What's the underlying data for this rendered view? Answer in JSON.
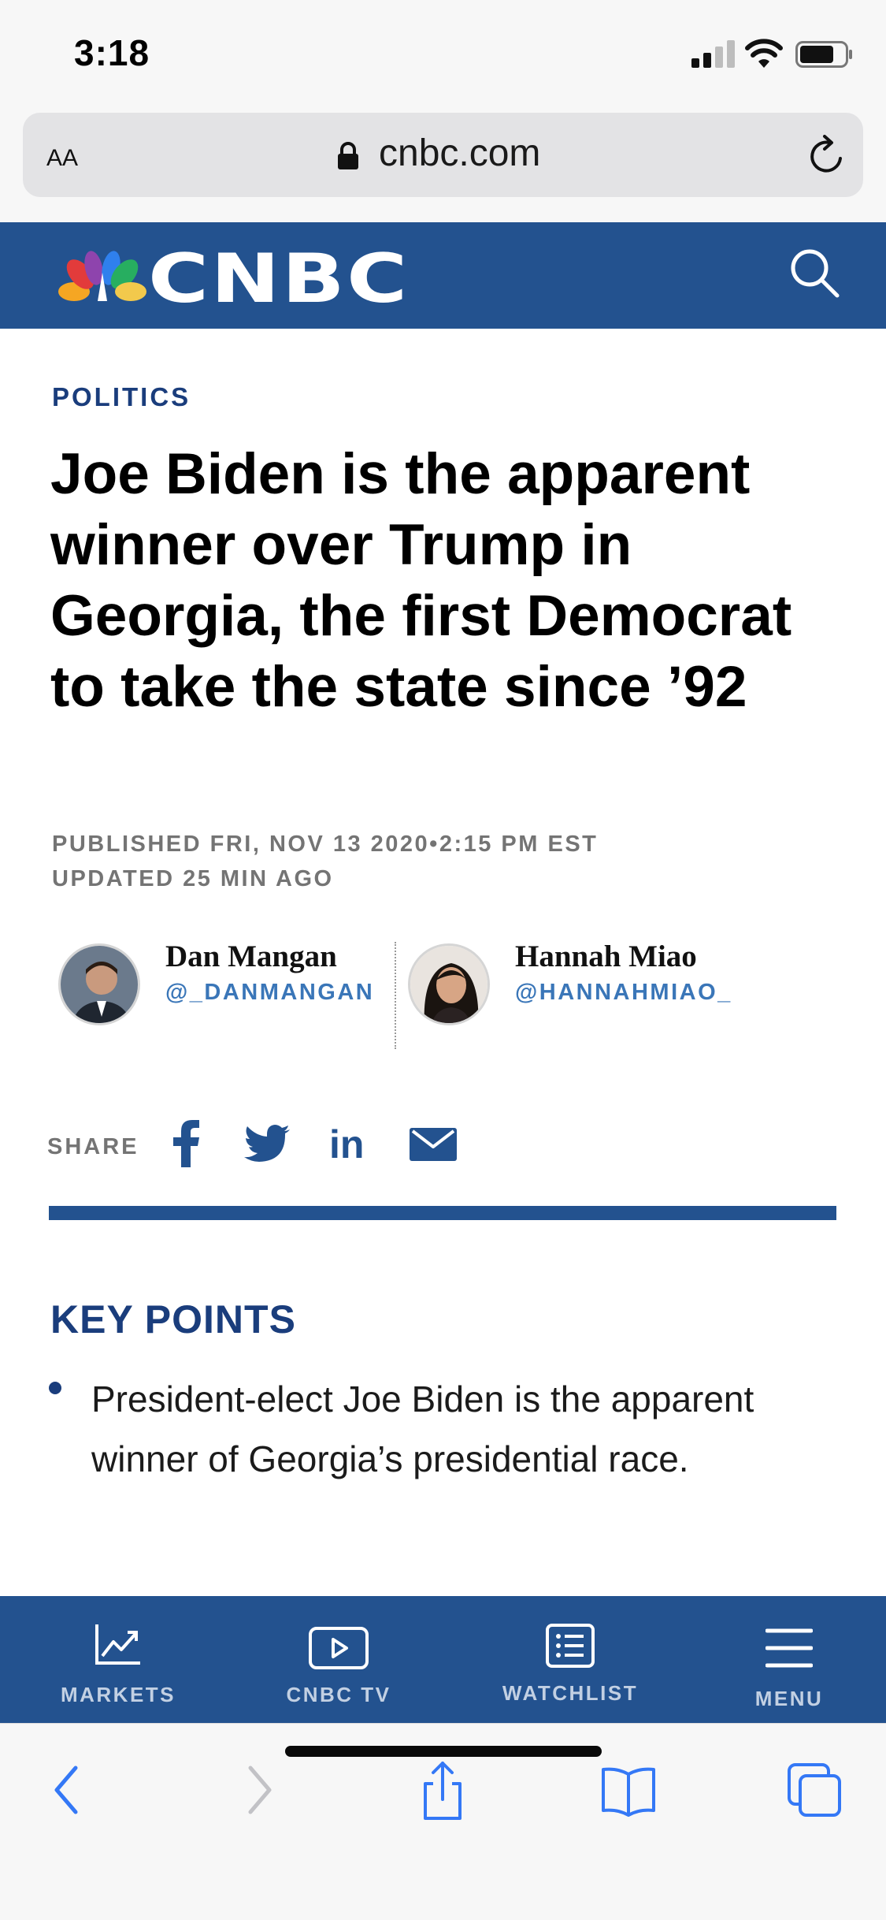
{
  "status_bar": {
    "time": "3:18",
    "icons": [
      "cellular-signal-icon",
      "wifi-icon",
      "battery-icon"
    ]
  },
  "browser": {
    "text_size_button": "AA",
    "url": "cnbc.com",
    "icons": [
      "lock-icon",
      "reload-icon"
    ]
  },
  "site_header": {
    "logo": "CNBC",
    "icons": [
      "nbc-peacock-icon",
      "search-icon"
    ],
    "brand_color": "#23528f"
  },
  "article": {
    "section": "POLITICS",
    "headline": "Joe Biden is the apparent winner over Trump in Georgia, the first Democrat to take the state since ’92",
    "published": "PUBLISHED FRI, NOV 13 2020•2:15 PM EST",
    "updated": "UPDATED 25 MIN AGO",
    "authors": [
      {
        "name": "Dan Mangan",
        "handle": "@_DANMANGAN"
      },
      {
        "name": "Hannah Miao",
        "handle": "@HANNAHMIAO_"
      }
    ],
    "share": {
      "label": "SHARE",
      "icons": [
        "facebook-icon",
        "twitter-icon",
        "linkedin-icon",
        "email-icon"
      ],
      "linkedin_glyph": "in"
    },
    "key_points": {
      "title": "KEY POINTS",
      "items": [
        "President-elect Joe Biden is the apparent winner of Georgia’s presidential race."
      ]
    }
  },
  "site_nav": {
    "items": [
      {
        "label": "MARKETS",
        "icon": "chart-icon"
      },
      {
        "label": "CNBC TV",
        "icon": "play-icon"
      },
      {
        "label": "WATCHLIST",
        "icon": "list-icon"
      },
      {
        "label": "MENU",
        "icon": "hamburger-menu-icon"
      }
    ]
  },
  "safari_toolbar": {
    "icons": [
      "back-icon",
      "forward-icon",
      "share-icon",
      "bookmarks-icon",
      "tabs-icon"
    ],
    "accent_color": "#3478f6"
  }
}
